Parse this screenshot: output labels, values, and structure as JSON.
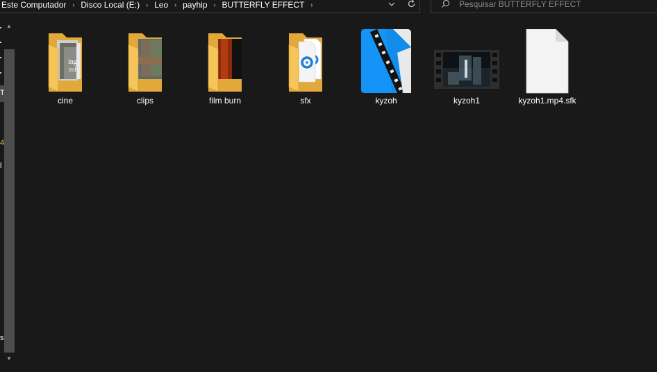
{
  "address_bar": {
    "breadcrumbs": [
      "Este Computador",
      "Disco Local (E:)",
      "Leo",
      "payhip",
      "BUTTERFLY EFFECT"
    ],
    "separator": "›",
    "dropdown_icon": "chevron-down-icon",
    "refresh_icon": "refresh-icon"
  },
  "search": {
    "placeholder": "Pesquisar BUTTERFLY EFFECT",
    "icon": "search-icon"
  },
  "nav_pane": {
    "fragments": [
      "T",
      "4",
      "l",
      "s"
    ]
  },
  "files": [
    {
      "name": "cine",
      "type": "folder",
      "icon": "folder-with-thumbnails-icon"
    },
    {
      "name": "clips",
      "type": "folder",
      "icon": "folder-with-thumbnails-icon"
    },
    {
      "name": "film burn",
      "type": "folder",
      "icon": "folder-with-thumbnails-icon"
    },
    {
      "name": "sfx",
      "type": "folder",
      "icon": "folder-with-audio-files-icon"
    },
    {
      "name": "kyzoh",
      "type": "project",
      "icon": "alight-motion-file-icon"
    },
    {
      "name": "kyzoh1",
      "type": "video",
      "icon": "video-thumbnail-icon"
    },
    {
      "name": "kyzoh1.mp4.sfk",
      "type": "file",
      "icon": "blank-file-icon"
    }
  ],
  "colors": {
    "background": "#191919",
    "border": "#3f3f3f",
    "folder": "#f5c55a",
    "accent_blue": "#1e90ff"
  }
}
